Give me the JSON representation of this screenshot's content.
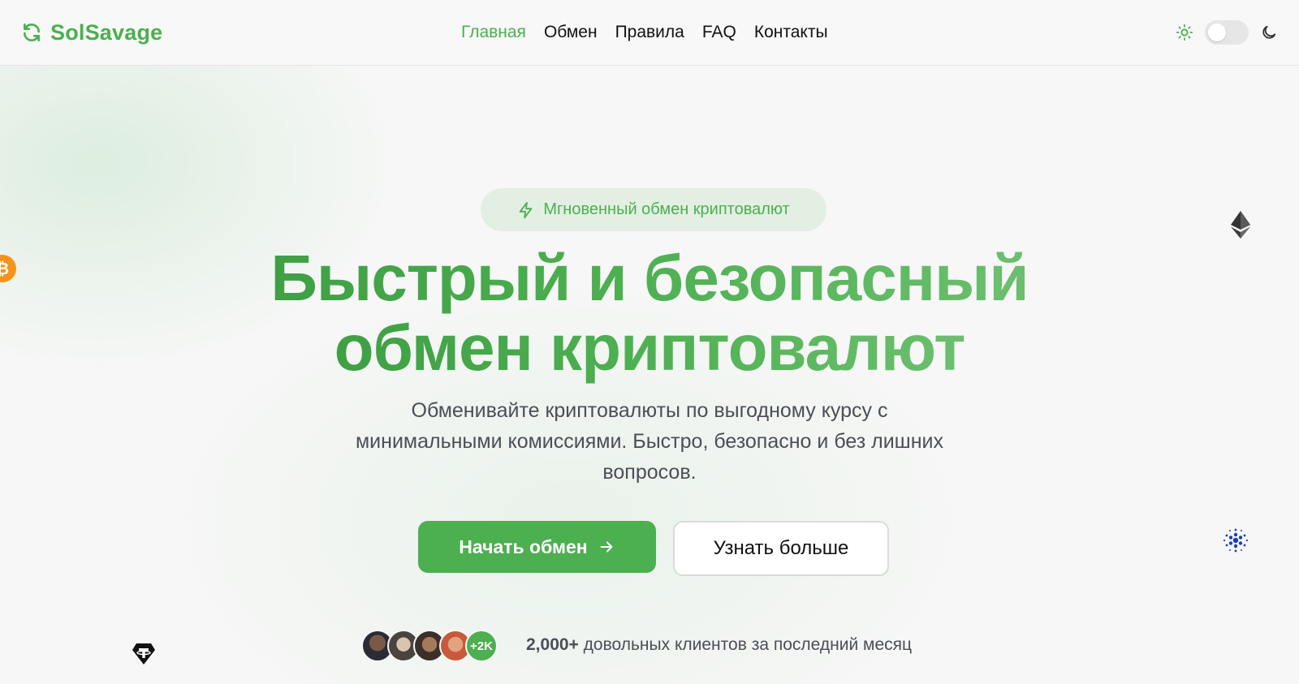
{
  "header": {
    "brand": "SolSavage",
    "nav": [
      {
        "label": "Главная",
        "active": true
      },
      {
        "label": "Обмен",
        "active": false
      },
      {
        "label": "Правила",
        "active": false
      },
      {
        "label": "FAQ",
        "active": false
      },
      {
        "label": "Контакты",
        "active": false
      }
    ],
    "theme": {
      "light_icon": "sun-icon",
      "dark_icon": "moon-icon",
      "dark_mode": false
    }
  },
  "hero": {
    "badge": "Мгновенный обмен криптовалют",
    "headline_line1": "Быстрый и безопасный",
    "headline_line2": "обмен криптовалют",
    "subtitle": "Обменивайте криптовалюты по выгодному курсу с минимальными комиссиями. Быстро, безопасно и без лишних вопросов.",
    "primary_button": "Начать обмен",
    "secondary_button": "Узнать больше",
    "avatars_more": "+2K",
    "clients_count": "2,000+",
    "clients_text": "довольных клиентов за последний месяц"
  },
  "floating_icons": [
    "bitcoin-icon",
    "ethereum-icon",
    "cardano-icon",
    "tether-icon"
  ],
  "colors": {
    "accent": "#4caf50",
    "text": "#111111",
    "muted": "#4b4f55",
    "background": "#f6f7f6"
  }
}
